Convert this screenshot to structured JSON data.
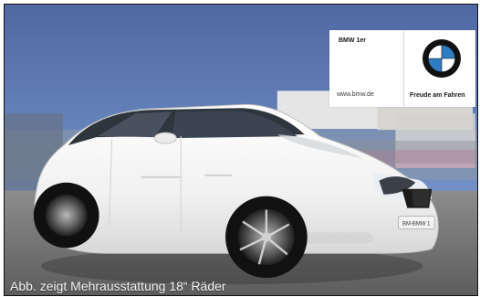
{
  "ad": {
    "model_text": "BMW 1er",
    "website_text": "www.bmw.de",
    "slogan_text": "Freude am Fahren",
    "caption_text": "Abb. zeigt Mehrausstattung 18“ Räder",
    "logo_icon": "bmw-logo-icon",
    "license_plate_text": "BM-BMW 1"
  },
  "colors": {
    "sky_top": "#4f68a4",
    "sky_bottom": "#8ea9d6",
    "car_white": "#f7f7f7",
    "road": "#7b7c7b",
    "brand_blue": "#2e7cc1"
  }
}
